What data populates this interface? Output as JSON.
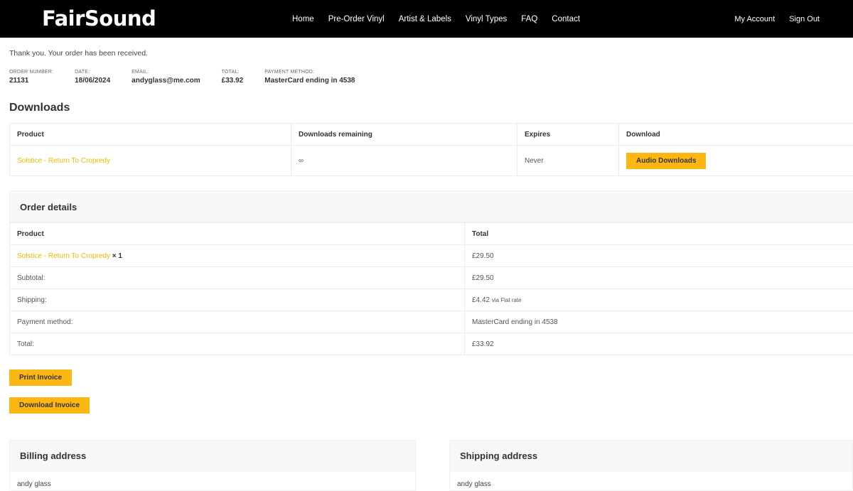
{
  "header": {
    "logo": "FairSound",
    "nav": [
      "Home",
      "Pre-Order Vinyl",
      "Artist & Labels",
      "Vinyl Types",
      "FAQ",
      "Contact"
    ],
    "account": [
      "My Account",
      "Sign Out"
    ]
  },
  "thanks_message": "Thank you. Your order has been received.",
  "overview": {
    "order_number": {
      "label": "ORDER NUMBER:",
      "value": "21131"
    },
    "date": {
      "label": "DATE:",
      "value": "18/06/2024"
    },
    "email": {
      "label": "EMAIL:",
      "value": "andyglass@me.com"
    },
    "total": {
      "label": "TOTAL:",
      "value": "£33.92"
    },
    "payment": {
      "label": "PAYMENT METHOD:",
      "value": "MasterCard ending in 4538"
    }
  },
  "downloads": {
    "title": "Downloads",
    "headers": {
      "product": "Product",
      "remaining": "Downloads remaining",
      "expires": "Expires",
      "download": "Download"
    },
    "row": {
      "product": "Solstice - Return To Cropredy",
      "remaining": "∞",
      "expires": "Never",
      "button": "Audio Downloads"
    }
  },
  "order_details": {
    "title": "Order details",
    "headers": {
      "product": "Product",
      "total": "Total"
    },
    "item": {
      "product": "Solstice - Return To Cropredy",
      "qty": "× 1",
      "total": "£29.50"
    },
    "subtotal": {
      "label": "Subtotal:",
      "value": "£29.50"
    },
    "shipping": {
      "label": "Shipping:",
      "value": "£4.42",
      "note": "via Flat rate"
    },
    "payment_method": {
      "label": "Payment method:",
      "value": "MasterCard ending in 4538"
    },
    "total": {
      "label": "Total:",
      "value": "£33.92"
    }
  },
  "buttons": {
    "print_invoice": "Print Invoice",
    "download_invoice": "Download Invoice"
  },
  "billing": {
    "title": "Billing address",
    "name": "andy glass"
  },
  "shipping_addr": {
    "title": "Shipping address",
    "name": "andy glass"
  },
  "colors": {
    "accent": "#fdb713",
    "header_bg": "#000000",
    "link": "#f5b800"
  }
}
